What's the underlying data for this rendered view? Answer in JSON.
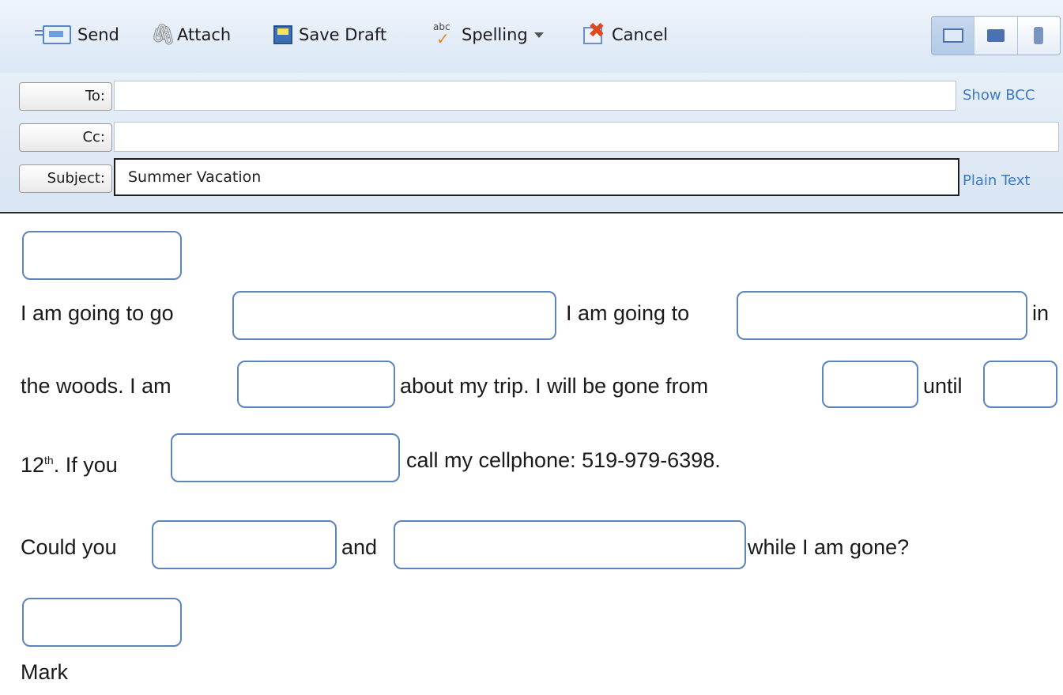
{
  "toolbar": {
    "send_label": "Send",
    "attach_label": "Attach",
    "save_draft_label": "Save Draft",
    "spelling_label": "Spelling",
    "cancel_label": "Cancel"
  },
  "header": {
    "to_label": "To:",
    "to_value": "",
    "show_bcc": "Show BCC",
    "cc_label": "Cc:",
    "cc_value": "",
    "subject_label": "Subject:",
    "subject_value": "Summer Vacation",
    "plain_text": "Plain Text"
  },
  "body": {
    "line1_a": "I am going to go",
    "line1_b": "I am going to",
    "line1_c": "in",
    "line2_a": "the woods.  I am",
    "line2_b": "about my trip.  I will be gone from",
    "line2_c": "until",
    "line3_num": "12",
    "line3_sup": "th",
    "line3_a": ".  If you",
    "line3_b": "call my cellphone: 519-979-6398.",
    "line4_a": "Could you",
    "line4_b": "and",
    "line4_c": "while I am gone?",
    "signature": "Mark"
  },
  "colors": {
    "link": "#3b79c6",
    "blank_border": "#5c84bf",
    "toolbar_bg": "#dbe7f5"
  },
  "icons": [
    "send-icon",
    "paperclip-icon",
    "save-disk-icon",
    "spellcheck-icon",
    "cancel-icon",
    "mail-view-icon",
    "message-view-icon",
    "phone-view-icon"
  ]
}
